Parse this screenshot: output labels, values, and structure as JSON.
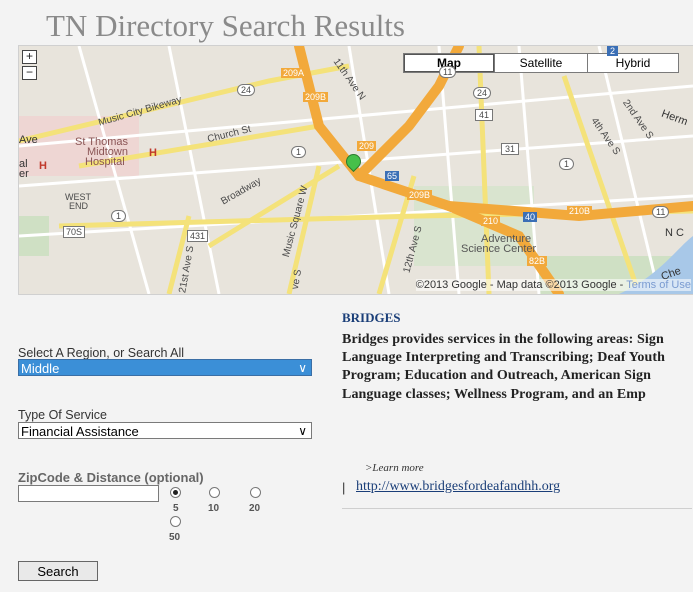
{
  "page": {
    "title": "TN Directory Search Results"
  },
  "map": {
    "types": [
      "Map",
      "Satellite",
      "Hybrid"
    ],
    "active_type": "Map",
    "zoom_in": "+",
    "zoom_out": "−",
    "labels": {
      "music_city_bikeway": "Music City Bikeway",
      "church_st": "Church St",
      "st_thomas_1": "St Thomas",
      "st_thomas_2": "Midtown",
      "st_thomas_3": "Hospital",
      "west_end_1": "WEST",
      "west_end_2": "END",
      "broadway": "Broadway",
      "music_square_w": "Music Square W",
      "eleventh_ave_n": "11th Ave N",
      "twelfth_ave_s": "12th Ave S",
      "fourth_ave_s": "4th Ave S",
      "second_ave_s": "2nd Ave S",
      "twenty_first_ave_s": "21st Ave S",
      "adventure_1": "Adventure",
      "adventure_2": "Science Center",
      "ave": "Ave",
      "herm": "Herm",
      "che": "Che",
      "nc": "N C",
      "ave_s": "ve S",
      "h_left": "H",
      "al_er": "al",
      "er": "er"
    },
    "shields": [
      "209A",
      "209B",
      "24",
      "11",
      "24",
      "41",
      "209",
      "1",
      "31",
      "1",
      "65",
      "209B",
      "210",
      "40",
      "210B",
      "11",
      "70S",
      "1",
      "431",
      "82B",
      "2"
    ],
    "copyright_text": "©2013 Google - Map data ©2013 Google - ",
    "terms_text": "Terms of Use"
  },
  "form": {
    "region_label": "Select A Region, or Search All",
    "region_value": "Middle",
    "service_label": "Type Of Service",
    "service_value": "Financial Assistance",
    "zip_label": "ZipCode & Distance (optional)",
    "zip_value": "",
    "distances": [
      "5",
      "10",
      "20",
      "50"
    ],
    "selected_distance": "5",
    "search_label": "Search"
  },
  "result": {
    "title": "BRIDGES",
    "description": "Bridges provides services in the following areas: Sign Language Interpreting and Transcribing; Deaf Youth Program; Education and Outreach, American Sign Language classes; Wellness Program, and an Emp",
    "learn_more": ">Learn more",
    "separator": "|",
    "link": "http://www.bridgesfordeafandhh.org"
  },
  "colors": {
    "title": "#8a8a8a",
    "accent_link": "#1a3e78",
    "selected": "#3b8fd7"
  }
}
